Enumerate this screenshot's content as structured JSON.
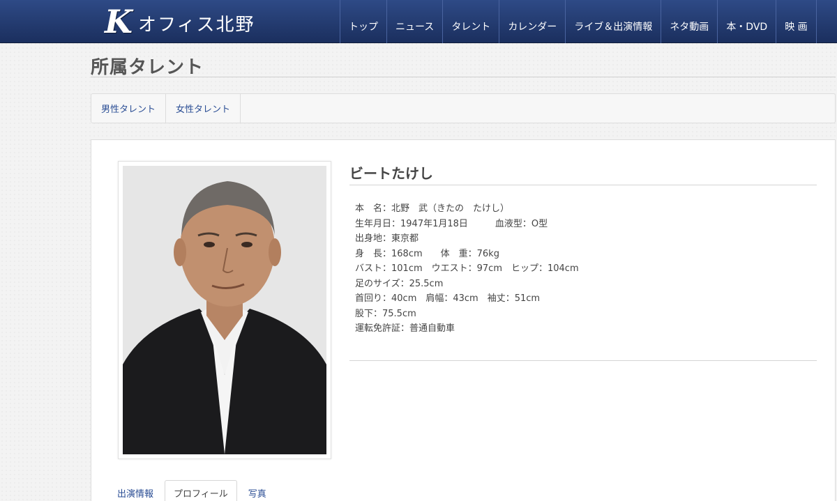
{
  "header": {
    "logo_mark": "K",
    "logo_text": "オフィス北野",
    "nav": [
      "トップ",
      "ニュース",
      "タレント",
      "カレンダー",
      "ライブ＆出演情報",
      "ネタ動画",
      "本・DVD",
      "映 画"
    ]
  },
  "page_title": "所属タレント",
  "categories": [
    "男性タレント",
    "女性タレント"
  ],
  "talent": {
    "name": "ビートたけし",
    "profile": [
      "本　名：北野　武（きたの　たけし）",
      "生年月日：1947年1月18日　　　血液型：O型",
      "出身地：東京都",
      "身　長：168cm　　体　重：76kg",
      "バスト：101cm　ウエスト：97cm　ヒップ：104cm",
      "足のサイズ：25.5cm",
      "首回り：40cm　肩幅：43cm　袖丈：51cm",
      "股下：75.5cm",
      "運転免許証：普通自動車"
    ]
  },
  "sub_tabs": [
    "出演情報",
    "プロフィール",
    "写真"
  ],
  "colors": {
    "header": "#1f3468",
    "link": "#2a4d94"
  }
}
